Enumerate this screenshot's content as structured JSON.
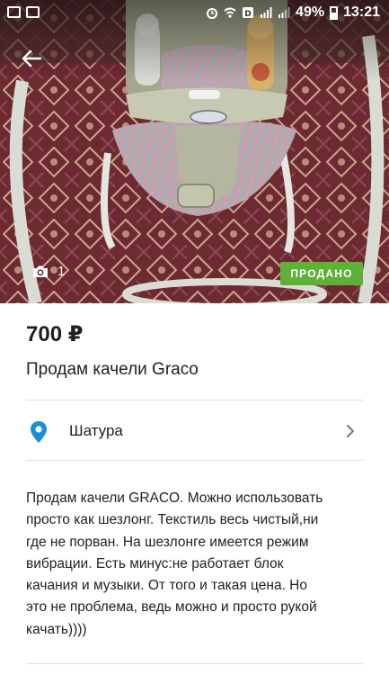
{
  "status_bar": {
    "battery_percent": "49%",
    "time": "13:21"
  },
  "gallery": {
    "photo_count": "1",
    "sold_badge": "ПРОДАНО"
  },
  "listing": {
    "price": "700 ₽",
    "title": "Продам качели Graco",
    "location": "Шатура",
    "description": "Продам качели GRACO. Можно использовать\nпросто как шезлонг. Текстиль весь чистый,ни\nгде не порван. На шезлонге имеется режим\nвибрации. Есть минус:не работает блок\nкачания и музыки. От того и такая цена. Но\nэто не проблема, ведь можно и просто рукой\nкачать))))"
  },
  "colors": {
    "sold_badge": "#5fb038",
    "location_pin": "#1a8fd6"
  }
}
